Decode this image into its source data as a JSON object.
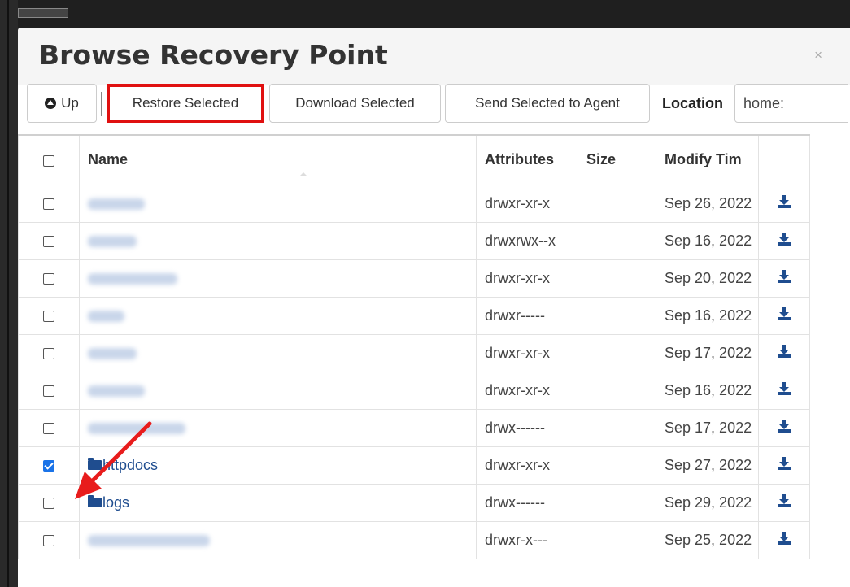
{
  "dialog": {
    "title": "Browse Recovery Point",
    "close_glyph": "×"
  },
  "toolbar": {
    "up_label": "Up",
    "restore_label": "Restore Selected",
    "download_label": "Download Selected",
    "send_label": "Send Selected to Agent",
    "location_label": "Location",
    "location_value": "home:"
  },
  "table": {
    "headers": {
      "name": "Name",
      "attributes": "Attributes",
      "size": "Size",
      "modified": "Modify Tim"
    },
    "rows": [
      {
        "name": "",
        "blurred": true,
        "attributes": "drwxr-xr-x",
        "size": "",
        "modified": "Sep 26, 2022",
        "checked": false
      },
      {
        "name": "",
        "blurred": true,
        "attributes": "drwxrwx--x",
        "size": "",
        "modified": "Sep 16, 2022",
        "checked": false
      },
      {
        "name": "",
        "blurred": true,
        "attributes": "drwxr-xr-x",
        "size": "",
        "modified": "Sep 20, 2022",
        "checked": false
      },
      {
        "name": "",
        "blurred": true,
        "attributes": "drwxr-----",
        "size": "",
        "modified": "Sep 16, 2022",
        "checked": false
      },
      {
        "name": "",
        "blurred": true,
        "attributes": "drwxr-xr-x",
        "size": "",
        "modified": "Sep 17, 2022",
        "checked": false
      },
      {
        "name": "",
        "blurred": true,
        "attributes": "drwxr-xr-x",
        "size": "",
        "modified": "Sep 16, 2022",
        "checked": false
      },
      {
        "name": "",
        "blurred": true,
        "attributes": "drwx------",
        "size": "",
        "modified": "Sep 17, 2022",
        "checked": false
      },
      {
        "name": "httpdocs",
        "blurred": false,
        "attributes": "drwxr-xr-x",
        "size": "",
        "modified": "Sep 27, 2022",
        "checked": true
      },
      {
        "name": "logs",
        "blurred": false,
        "attributes": "drwx------",
        "size": "",
        "modified": "Sep 29, 2022",
        "checked": false
      },
      {
        "name": "",
        "blurred": true,
        "attributes": "drwxr-x---",
        "size": "",
        "modified": "Sep 25, 2022",
        "checked": false
      }
    ]
  },
  "annotations": {
    "highlight_color": "#e01010",
    "arrow_color": "#e81c1c"
  },
  "icons": {
    "up": "circle-arrow-up-icon",
    "folder": "folder-icon",
    "download": "download-icon"
  }
}
